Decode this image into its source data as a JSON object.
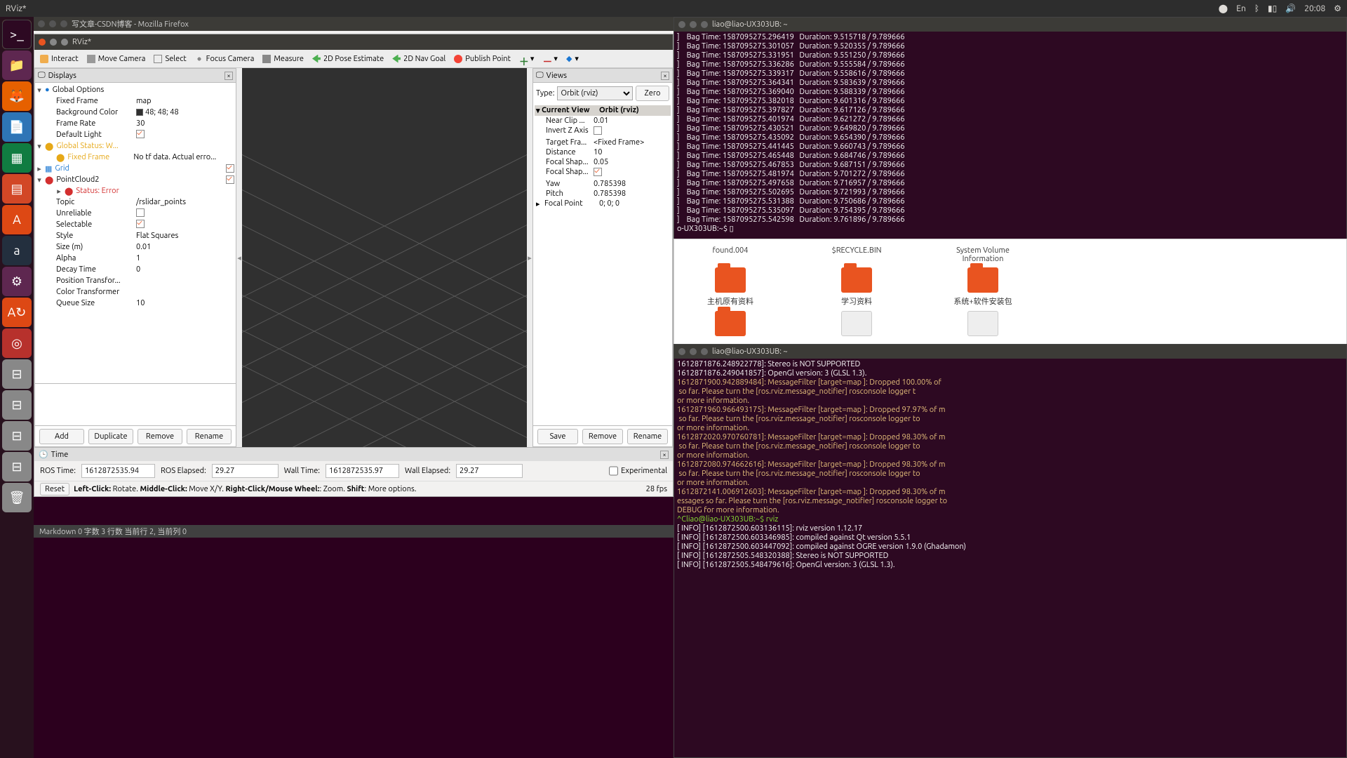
{
  "topbar": {
    "title": "RViz*",
    "lang": "En",
    "time": "20:08"
  },
  "firefox_title": "写文章-CSDN博客 - Mozilla Firefox",
  "rviz": {
    "title": "RViz*",
    "tools": [
      "Interact",
      "Move Camera",
      "Select",
      "Focus Camera",
      "Measure",
      "2D Pose Estimate",
      "2D Nav Goal",
      "Publish Point"
    ],
    "displays_panel_title": "Displays",
    "views_panel_title": "Views",
    "tree": {
      "global_options": "Global Options",
      "fixed_frame_k": "Fixed Frame",
      "fixed_frame_v": "map",
      "bg_k": "Background Color",
      "bg_v": "48; 48; 48",
      "fr_k": "Frame Rate",
      "fr_v": "30",
      "dl_k": "Default Light",
      "gstatus": "Global Status: W...",
      "ff2_k": "Fixed Frame",
      "ff2_v": "No tf data. Actual erro...",
      "grid": "Grid",
      "pc": "PointCloud2",
      "stat_err": "Status: Error",
      "topic_k": "Topic",
      "topic_v": "/rslidar_points",
      "unrel_k": "Unreliable",
      "sel_k": "Selectable",
      "style_k": "Style",
      "style_v": "Flat Squares",
      "size_k": "Size (m)",
      "size_v": "0.01",
      "alpha_k": "Alpha",
      "alpha_v": "1",
      "decay_k": "Decay Time",
      "decay_v": "0",
      "posx_k": "Position Transfor...",
      "colx_k": "Color Transformer",
      "queue_k": "Queue Size",
      "queue_v": "10"
    },
    "disp_btns": {
      "add": "Add",
      "dup": "Duplicate",
      "rem": "Remove",
      "ren": "Rename"
    },
    "views": {
      "type_label": "Type:",
      "type_value": "Orbit (rviz)",
      "zero": "Zero",
      "current_view": "Current View",
      "orbit": "Orbit (rviz)",
      "near_k": "Near Clip ...",
      "near_v": "0.01",
      "invz_k": "Invert Z Axis",
      "tf_k": "Target Fra...",
      "tf_v": "<Fixed Frame>",
      "dist_k": "Distance",
      "dist_v": "10",
      "fss_k": "Focal Shap...",
      "fss_v": "0.05",
      "fsf_k": "Focal Shap...",
      "yaw_k": "Yaw",
      "yaw_v": "0.785398",
      "pitch_k": "Pitch",
      "pitch_v": "0.785398",
      "fp_k": "Focal Point",
      "fp_v": "0; 0; 0",
      "save": "Save",
      "remove": "Remove",
      "rename": "Rename"
    },
    "time": {
      "panel": "Time",
      "rostime_l": "ROS Time:",
      "rostime_v": "1612872535.94",
      "roselap_l": "ROS Elapsed:",
      "roselap_v": "29.27",
      "walltime_l": "Wall Time:",
      "walltime_v": "1612872535.97",
      "wallelap_l": "Wall Elapsed:",
      "wallelap_v": "29.27",
      "exp": "Experimental"
    },
    "status": {
      "reset": "Reset",
      "hint": "Left-Click: Rotate. Middle-Click: Move X/Y. Right-Click/Mouse Wheel:: Zoom. Shift: More options.",
      "fps": "28 fps"
    },
    "md_status": "Markdown  0 字数  3 行数  当前行 2, 当前列 0"
  },
  "term1": {
    "title": "liao@liao-UX303UB: ~",
    "lines": [
      "]    Bag Time: 1587095275.296419   Duration: 9.515718 / 9.789666",
      "]    Bag Time: 1587095275.301057   Duration: 9.520355 / 9.789666",
      "]    Bag Time: 1587095275.331951   Duration: 9.551250 / 9.789666",
      "]    Bag Time: 1587095275.336286   Duration: 9.555584 / 9.789666",
      "]    Bag Time: 1587095275.339317   Duration: 9.558616 / 9.789666",
      "]    Bag Time: 1587095275.364341   Duration: 9.583639 / 9.789666",
      "]    Bag Time: 1587095275.369040   Duration: 9.588339 / 9.789666",
      "]    Bag Time: 1587095275.382018   Duration: 9.601316 / 9.789666",
      "]    Bag Time: 1587095275.397827   Duration: 9.617126 / 9.789666",
      "]    Bag Time: 1587095275.401974   Duration: 9.621272 / 9.789666",
      "]    Bag Time: 1587095275.430521   Duration: 9.649820 / 9.789666",
      "]    Bag Time: 1587095275.435092   Duration: 9.654390 / 9.789666",
      "]    Bag Time: 1587095275.441445   Duration: 9.660743 / 9.789666",
      "]    Bag Time: 1587095275.465448   Duration: 9.684746 / 9.789666",
      "]    Bag Time: 1587095275.467853   Duration: 9.687151 / 9.789666",
      "]    Bag Time: 1587095275.481974   Duration: 9.701272 / 9.789666",
      "]    Bag Time: 1587095275.497658   Duration: 9.716957 / 9.789666",
      "]    Bag Time: 1587095275.502695   Duration: 9.721993 / 9.789666",
      "]    Bag Time: 1587095275.531388   Duration: 9.750686 / 9.789666",
      "]    Bag Time: 1587095275.535097   Duration: 9.754395 / 9.789666",
      "]    Bag Time: 1587095275.542598   Duration: 9.761896 / 9.789666"
    ],
    "prompt": "o-UX303UB:~$ ▯"
  },
  "files": {
    "items": [
      {
        "name": "found.004",
        "type": "folder"
      },
      {
        "name": "$RECYCLE.BIN",
        "type": "folder"
      },
      {
        "name": "System Volume Information",
        "type": "folder"
      },
      {
        "name": "主机原有资料",
        "type": "folder"
      },
      {
        "name": "学习资料",
        "type": "folder"
      },
      {
        "name": "系统+软件安装包",
        "type": "folder"
      },
      {
        "name": "",
        "type": "folder"
      },
      {
        "name": "",
        "type": "doc"
      },
      {
        "name": "",
        "type": "doc"
      }
    ]
  },
  "term2": {
    "title": "liao@liao-UX303UB: ~",
    "lines": [
      "1612871876.248922778]: Stereo is NOT SUPPORTED",
      "1612871876.249041857]: OpenGl version: 3 (GLSL 1.3).",
      "1612871900.942889484]: MessageFilter [target=map ]: Dropped 100.00% of",
      " so far. Please turn the [ros.rviz.message_notifier] rosconsole logger t",
      "or more information.",
      "1612871960.966493175]: MessageFilter [target=map ]: Dropped 97.97% of m",
      " so far. Please turn the [ros.rviz.message_notifier] rosconsole logger to",
      "or more information.",
      "1612872020.970760781]: MessageFilter [target=map ]: Dropped 98.30% of m",
      " so far. Please turn the [ros.rviz.message_notifier] rosconsole logger to",
      "or more information.",
      "1612872080.974662616]: MessageFilter [target=map ]: Dropped 98.30% of m",
      " so far. Please turn the [ros.rviz.message_notifier] rosconsole logger to",
      "or more information.",
      "1612872141.006912603]: MessageFilter [target=map ]: Dropped 98.30% of m",
      "essages so far. Please turn the [ros.rviz.message_notifier] rosconsole logger to",
      "DEBUG for more information."
    ],
    "prompt": "^Cliao@liao-UX303UB:~$ rviz",
    "info": [
      "[ INFO] [1612872500.603136115]: rviz version 1.12.17",
      "[ INFO] [1612872500.603346985]: compiled against Qt version 5.5.1",
      "[ INFO] [1612872500.603447092]: compiled against OGRE version 1.9.0 (Ghadamon)",
      "[ INFO] [1612872505.548320388]: Stereo is NOT SUPPORTED",
      "[ INFO] [1612872505.548479616]: OpenGl version: 3 (GLSL 1.3)."
    ]
  }
}
